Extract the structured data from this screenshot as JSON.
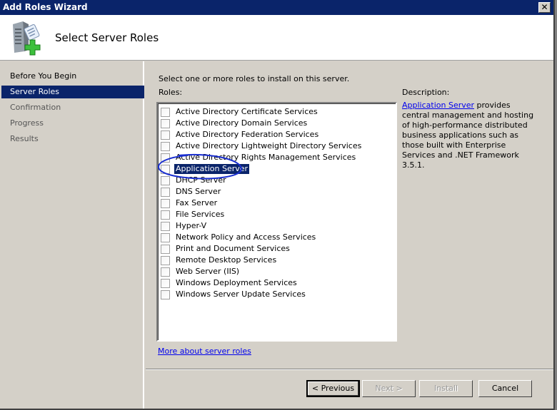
{
  "window": {
    "title": "Add Roles Wizard",
    "close_icon": "close-icon"
  },
  "header": {
    "title": "Select Server Roles",
    "icon": "server-add-icon"
  },
  "nav": {
    "items": [
      {
        "label": "Before You Begin",
        "state": "normal"
      },
      {
        "label": "Server Roles",
        "state": "active"
      },
      {
        "label": "Confirmation",
        "state": "disabled"
      },
      {
        "label": "Progress",
        "state": "disabled"
      },
      {
        "label": "Results",
        "state": "disabled"
      }
    ]
  },
  "main": {
    "intro": "Select one or more roles to install on this server.",
    "roles_label": "Roles:",
    "roles": [
      {
        "label": "Active Directory Certificate Services",
        "checked": false,
        "selected": false
      },
      {
        "label": "Active Directory Domain Services",
        "checked": false,
        "selected": false
      },
      {
        "label": "Active Directory Federation Services",
        "checked": false,
        "selected": false
      },
      {
        "label": "Active Directory Lightweight Directory Services",
        "checked": false,
        "selected": false
      },
      {
        "label": "Active Directory Rights Management Services",
        "checked": false,
        "selected": false
      },
      {
        "label": "Application Server",
        "checked": false,
        "selected": true
      },
      {
        "label": "DHCP Server",
        "checked": false,
        "selected": false
      },
      {
        "label": "DNS Server",
        "checked": false,
        "selected": false
      },
      {
        "label": "Fax Server",
        "checked": false,
        "selected": false
      },
      {
        "label": "File Services",
        "checked": false,
        "selected": false
      },
      {
        "label": "Hyper-V",
        "checked": false,
        "selected": false
      },
      {
        "label": "Network Policy and Access Services",
        "checked": false,
        "selected": false
      },
      {
        "label": "Print and Document Services",
        "checked": false,
        "selected": false
      },
      {
        "label": "Remote Desktop Services",
        "checked": false,
        "selected": false
      },
      {
        "label": "Web Server (IIS)",
        "checked": false,
        "selected": false
      },
      {
        "label": "Windows Deployment Services",
        "checked": false,
        "selected": false
      },
      {
        "label": "Windows Server Update Services",
        "checked": false,
        "selected": false
      }
    ],
    "more_link": "More about server roles",
    "description_label": "Description:",
    "description_link": "Application Server",
    "description_text": " provides central management and hosting of high-performance distributed business applications such as those built with Enterprise Services and .NET Framework 3.5.1."
  },
  "buttons": {
    "previous": "< Previous",
    "next": "Next >",
    "install": "Install",
    "cancel": "Cancel"
  },
  "annotation": {
    "color": "#1a2fd0",
    "target": "Application Server"
  }
}
